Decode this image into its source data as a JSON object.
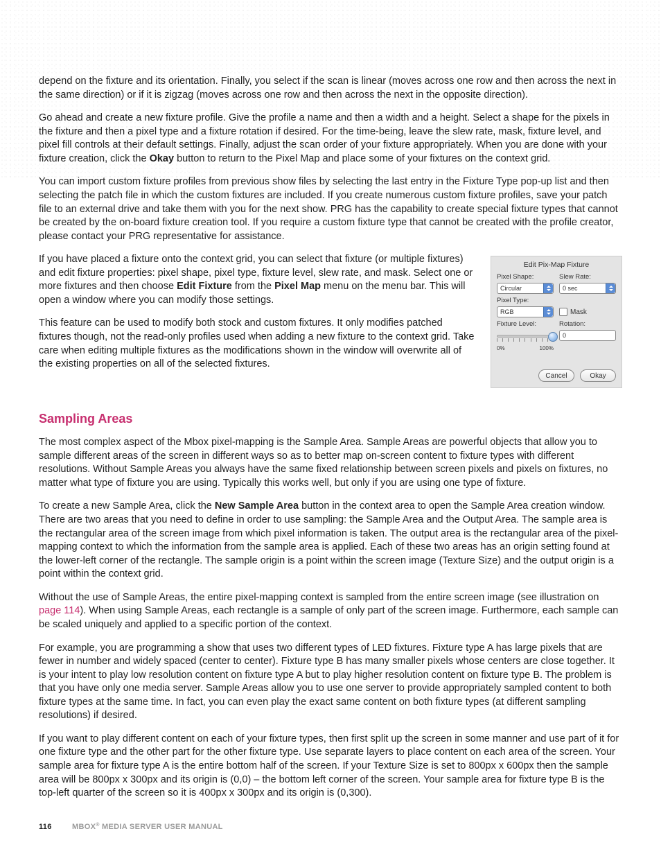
{
  "colors": {
    "accent": "#c72f6f"
  },
  "para1": "depend on the fixture and its orientation. Finally, you select if the scan is linear (moves across one row and then across the next in the same direction) or if it is zigzag (moves across one row and then across the next in the opposite direction).",
  "para2a": "Go ahead and create a new fixture profile. Give the profile a name and then a width and a height. Select a shape for the pixels in the fixture and then a pixel type and a fixture rotation if desired. For the time-being, leave the slew rate, mask, fixture level, and pixel fill controls at their default settings. Finally, adjust the scan order of your fixture appropriately. When you are done with your fixture creation, click the ",
  "okay_word": "Okay",
  "para2b": " button to return to the Pixel Map and place some of your fixtures on the context grid.",
  "para3": "You can import custom fixture profiles from previous show files by selecting the last entry in the Fixture Type pop-up list and then selecting the patch file in which the custom fixtures are included. If you create numerous custom fixture profiles, save your patch file to an external drive and take them with you for the next show. PRG has the capability to create special fixture types that cannot be created by the on-board fixture creation tool. If you require a custom fixture type that cannot be created with the profile creator, please contact your PRG representative for assistance.",
  "para4a": "If you have placed a fixture onto the context grid, you can select that fixture (or multiple fixtures) and edit fixture properties: pixel shape, pixel type, fixture level, slew rate, and mask. Select one or more fixtures and then choose ",
  "edit_fixture": "Edit Fixture",
  "para4b": " from the ",
  "pixel_map": "Pixel Map",
  "para4c": " menu on the menu bar. This will open a window where you can modify those settings.",
  "para5": "This feature can be used to modify both stock and custom fixtures. It only modifies patched fixtures though, not the read-only profiles used when adding a new fixture to the context grid. Take care when editing multiple fixtures as the modifications shown in the window will overwrite all of the existing properties on all of the selected fixtures.",
  "heading": "Sampling Areas",
  "para6": "The most complex aspect of the Mbox pixel-mapping is the Sample Area. Sample Areas are powerful objects that allow you to sample different areas of the screen in different ways so as to better map on-screen content to fixture types with different resolutions. Without Sample Areas you always have the same fixed relationship between screen pixels and pixels on fixtures, no matter what type of fixture you are using. Typically this works well, but only if you are using one type of fixture.",
  "para7a": "To create a new Sample Area, click the ",
  "new_sample_area": "New Sample Area",
  "para7b": " button in the context area to open the Sample Area creation window. There are two areas that you need to define in order to use sampling: the Sample Area and the Output Area. The sample area is the rectangular area of the screen image from which pixel information is taken. The output area is the rectangular area of the pixel-mapping context to which the information from the sample area is applied. Each of these two areas has an origin setting found at the lower-left corner of the rectangle. The sample origin is a point within the screen image (Texture Size) and the output origin is a point within the context grid.",
  "para8a": "Without the use of Sample Areas, the entire pixel-mapping context is sampled from the entire screen image (see illustration on ",
  "page_link": "page 114",
  "para8b": "). When using Sample Areas, each rectangle is a sample of only part of the screen image. Furthermore, each sample can be scaled uniquely and applied to a specific portion of the context.",
  "para9": "For example, you are programming a show that uses two different types of LED fixtures. Fixture type A has large pixels that are fewer in number and widely spaced (center to center). Fixture type B has many smaller pixels whose centers are close together. It is your intent to play low resolution content on fixture type A but to play higher resolution content on fixture type B. The problem is that you have only one media server. Sample Areas allow you to use one server to provide appropriately sampled content to both fixture types at the same time. In fact, you can even play the exact same content on both fixture types (at different sampling resolutions) if desired.",
  "para10": "If you want to play different content on each of your fixture types, then first split up the screen in some manner and use part of it for one fixture type and the other part for the other fixture type. Use separate layers to place content on each area of the screen. Your sample area for fixture type A is the entire bottom half of the screen. If your Texture Size is set to 800px x 600px then the sample area will be 800px x 300px and its origin is (0,0) – the bottom left corner of the screen. Your sample area for fixture type B is the top-left quarter of the screen so it is 400px x 300px and its origin is (0,300).",
  "dialog": {
    "title": "Edit Pix-Map Fixture",
    "pixel_shape_label": "Pixel Shape:",
    "pixel_shape_value": "Circular",
    "slew_rate_label": "Slew Rate:",
    "slew_rate_value": "0 sec",
    "pixel_type_label": "Pixel Type:",
    "pixel_type_value": "RGB",
    "mask_label": "Mask",
    "fixture_level_label": "Fixture Level:",
    "rotation_label": "Rotation:",
    "rotation_value": "0",
    "min": "0%",
    "max": "100%",
    "cancel": "Cancel",
    "okay": "Okay"
  },
  "footer": {
    "page": "116",
    "title_prefix": "MBOX",
    "title_suffix": " MEDIA SERVER USER MANUAL"
  }
}
